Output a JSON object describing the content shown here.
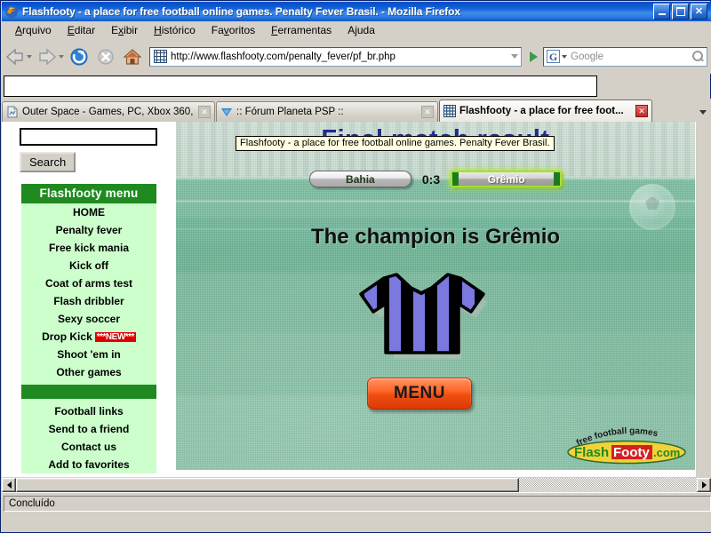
{
  "window": {
    "title": "Flashfooty - a place for free football online games. Penalty Fever Brasil. - Mozilla Firefox",
    "icon": "firefox-icon",
    "minimize_label": "_",
    "maximize_label": "□",
    "close_label": "✕"
  },
  "menubar": {
    "items": [
      {
        "label": "Arquivo",
        "accel": "A"
      },
      {
        "label": "Editar",
        "accel": "E"
      },
      {
        "label": "Exibir",
        "accel": "x"
      },
      {
        "label": "Histórico",
        "accel": "H"
      },
      {
        "label": "Favoritos",
        "accel": "v"
      },
      {
        "label": "Ferramentas",
        "accel": "F"
      },
      {
        "label": "Ajuda",
        "accel": "j"
      }
    ]
  },
  "toolbar": {
    "back_label": "Voltar",
    "forward_label": "Avançar",
    "reload_label": "Recarregar",
    "stop_label": "Parar",
    "home_label": "Página inicial",
    "url": "http://www.flashfooty.com/penalty_fever/pf_br.php",
    "url_placeholder": "",
    "go_label": "Ir",
    "search_engine": "G",
    "search_value": "",
    "search_placeholder": "Google"
  },
  "tabs": [
    {
      "label": "Outer Space - Games, PC, Xbox 360, ...",
      "favicon": "page-icon",
      "active": false,
      "close_label": "✕"
    },
    {
      "label": ":: Fórum Planeta PSP ::",
      "favicon": "psp-icon",
      "active": false,
      "close_label": "✕"
    },
    {
      "label": "Flashfooty - a place for free foot...",
      "favicon": "flashfooty-icon",
      "active": true,
      "close_label": "✕"
    }
  ],
  "tablist_button_label": "▾",
  "sidebar": {
    "search_value": "",
    "search_placeholder": "",
    "search_button_label": "Search",
    "menu_title": "Flashfooty menu",
    "menu_items": [
      {
        "label": "HOME"
      },
      {
        "label": "Penalty fever"
      },
      {
        "label": "Free kick mania"
      },
      {
        "label": "Kick off"
      },
      {
        "label": "Coat of arms test"
      },
      {
        "label": "Flash dribbler"
      },
      {
        "label": "Sexy soccer"
      },
      {
        "label": "Drop Kick",
        "badge": "***NEW***"
      },
      {
        "label": "Shoot 'em in"
      },
      {
        "label": "Other games"
      }
    ],
    "menu_items_2": [
      {
        "label": "Football links"
      },
      {
        "label": "Send to a friend"
      },
      {
        "label": "Contact us"
      },
      {
        "label": "Add to favorites"
      }
    ]
  },
  "game": {
    "title": "Final match result",
    "home_team": "Bahia",
    "score": "0:3",
    "away_team": "Grêmio",
    "champion_text": "The champion is Grêmio",
    "menu_button_label": "MENU",
    "logo_tagline": "free football games",
    "logo_part1": "Flash",
    "logo_part2": "Footy",
    "logo_part3": ".com"
  },
  "tooltip": {
    "text": "Flashfooty - a place for free football online games. Penalty Fever Brasil."
  },
  "status": {
    "text": "Concluído"
  },
  "colors": {
    "titlebar_blue": "#0a50c8",
    "menu_green": "#1f8a1f",
    "menu_bg_green": "#ccffcc",
    "new_badge_red": "#e00000",
    "title_blue": "#1f2d8f",
    "menu_button_orange": "#ef4d12",
    "winner_glow": "#a6e12a",
    "jersey_blue": "#7b78e0",
    "jersey_black": "#000000",
    "field_green": "#7fc0a4"
  }
}
